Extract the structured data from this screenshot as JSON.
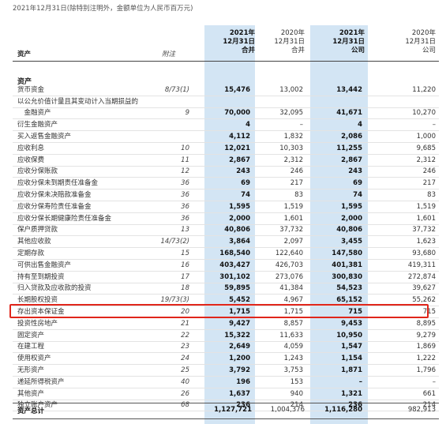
{
  "caption": "2021年12月31日(除特别注明外，金额单位为人民币百万元)",
  "header": {
    "col_label": "资产",
    "col_note": "附注",
    "c1": [
      "2021年",
      "12月31日",
      "合并"
    ],
    "c2": [
      "2020年",
      "12月31日",
      "合并"
    ],
    "c3": [
      "2021年",
      "12月31日",
      "公司"
    ],
    "c4": [
      "2020年",
      "12月31日",
      "公司"
    ]
  },
  "section": "资产",
  "rows": [
    {
      "label": "货币资金",
      "note": "8/73(1)",
      "v1": "15,476",
      "v2": "13,002",
      "v3": "13,442",
      "v4": "11,220"
    },
    {
      "label": "以公允价值计量且其变动计入当期损益的",
      "note": "",
      "v1": "",
      "v2": "",
      "v3": "",
      "v4": ""
    },
    {
      "label": "　金融资产",
      "note": "9",
      "v1": "70,000",
      "v2": "32,095",
      "v3": "41,671",
      "v4": "10,270"
    },
    {
      "label": "衍生金融资产",
      "note": "",
      "v1": "4",
      "v2": "–",
      "v3": "4",
      "v4": "–"
    },
    {
      "label": "买入返售金融资产",
      "note": "",
      "v1": "4,112",
      "v2": "1,832",
      "v3": "2,086",
      "v4": "1,000"
    },
    {
      "label": "应收利息",
      "note": "10",
      "v1": "12,021",
      "v2": "10,303",
      "v3": "11,255",
      "v4": "9,685"
    },
    {
      "label": "应收保费",
      "note": "11",
      "v1": "2,867",
      "v2": "2,312",
      "v3": "2,867",
      "v4": "2,312"
    },
    {
      "label": "应收分保账款",
      "note": "12",
      "v1": "243",
      "v2": "246",
      "v3": "243",
      "v4": "246"
    },
    {
      "label": "应收分保未到期责任准备金",
      "note": "36",
      "v1": "69",
      "v2": "217",
      "v3": "69",
      "v4": "217"
    },
    {
      "label": "应收分保未决赔款准备金",
      "note": "36",
      "v1": "74",
      "v2": "83",
      "v3": "74",
      "v4": "83"
    },
    {
      "label": "应收分保寿险责任准备金",
      "note": "36",
      "v1": "1,595",
      "v2": "1,519",
      "v3": "1,595",
      "v4": "1,519"
    },
    {
      "label": "应收分保长期健康险责任准备金",
      "note": "36",
      "v1": "2,000",
      "v2": "1,601",
      "v3": "2,000",
      "v4": "1,601"
    },
    {
      "label": "保户质押贷款",
      "note": "13",
      "v1": "40,806",
      "v2": "37,732",
      "v3": "40,806",
      "v4": "37,732"
    },
    {
      "label": "其他应收款",
      "note": "14/73(2)",
      "v1": "3,864",
      "v2": "2,097",
      "v3": "3,455",
      "v4": "1,623"
    },
    {
      "label": "定期存款",
      "note": "15",
      "v1": "168,540",
      "v2": "122,640",
      "v3": "147,580",
      "v4": "93,680"
    },
    {
      "label": "可供出售金融资产",
      "note": "16",
      "v1": "403,427",
      "v2": "426,703",
      "v3": "401,381",
      "v4": "419,311"
    },
    {
      "label": "持有至到期投资",
      "note": "17",
      "v1": "301,102",
      "v2": "273,076",
      "v3": "300,830",
      "v4": "272,874"
    },
    {
      "label": "归入贷款及应收款的投资",
      "note": "18",
      "v1": "59,895",
      "v2": "41,384",
      "v3": "54,523",
      "v4": "39,627"
    },
    {
      "label": "长期股权投资",
      "note": "19/73(3)",
      "v1": "5,452",
      "v2": "4,967",
      "v3": "65,152",
      "v4": "55,262"
    },
    {
      "label": "存出资本保证金",
      "note": "20",
      "v1": "1,715",
      "v2": "1,715",
      "v3": "715",
      "v4": "715"
    },
    {
      "label": "投资性房地产",
      "note": "21",
      "v1": "9,427",
      "v2": "8,857",
      "v3": "9,453",
      "v4": "8,895"
    },
    {
      "label": "固定资产",
      "note": "22",
      "v1": "15,322",
      "v2": "11,633",
      "v3": "10,950",
      "v4": "9,279"
    },
    {
      "label": "在建工程",
      "note": "23",
      "v1": "2,649",
      "v2": "4,059",
      "v3": "1,547",
      "v4": "1,869"
    },
    {
      "label": "使用权资产",
      "note": "24",
      "v1": "1,200",
      "v2": "1,243",
      "v3": "1,154",
      "v4": "1,222"
    },
    {
      "label": "无形资产",
      "note": "25",
      "v1": "3,792",
      "v2": "3,753",
      "v3": "1,871",
      "v4": "1,796"
    },
    {
      "label": "递延所得税资产",
      "note": "40",
      "v1": "196",
      "v2": "153",
      "v3": "–",
      "v4": "–"
    },
    {
      "label": "其他资产",
      "note": "26",
      "v1": "1,637",
      "v2": "940",
      "v3": "1,321",
      "v4": "661"
    },
    {
      "label": "独立账户资产",
      "note": "68",
      "v1": "236",
      "v2": "214",
      "v3": "236",
      "v4": "214"
    }
  ],
  "total": {
    "label": "资产总计",
    "v1": "1,127,721",
    "v2": "1,004,376",
    "v3": "1,116,280",
    "v4": "982,913"
  },
  "highlight_color": "#e0261b",
  "shade_color": "#d3e5f4"
}
